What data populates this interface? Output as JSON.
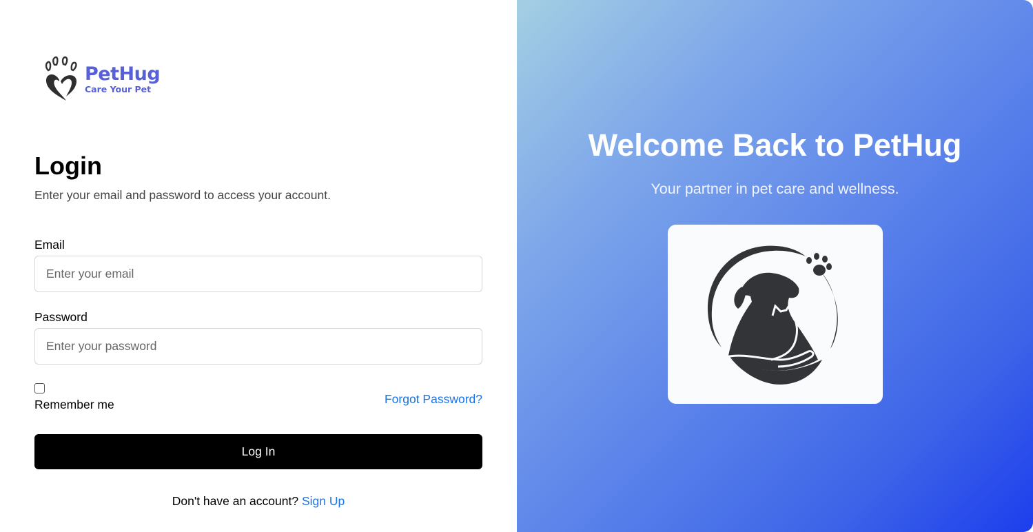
{
  "brand": {
    "name": "PetHug",
    "tagline": "Care Your Pet",
    "color": "#5860d8"
  },
  "login": {
    "title": "Login",
    "subtitle": "Enter your email and password to access your account.",
    "email_label": "Email",
    "email_placeholder": "Enter your email",
    "email_value": "",
    "password_label": "Password",
    "password_placeholder": "Enter your password",
    "password_value": "",
    "remember_label": "Remember me",
    "remember_checked": false,
    "forgot_label": "Forgot Password?",
    "submit_label": "Log In",
    "signup_prompt": "Don't have an account?",
    "signup_label": "Sign Up"
  },
  "hero": {
    "title": "Welcome Back to PetHug",
    "subtitle": "Your partner in pet care and wellness.",
    "image_icon": "dog-cat-hand-icon"
  },
  "colors": {
    "link": "#1a73e8",
    "button": "#000000",
    "gradient_start": "#a4cfe2",
    "gradient_end": "#1c3ded"
  },
  "icons": {
    "logo": "paw-heart-icon"
  }
}
